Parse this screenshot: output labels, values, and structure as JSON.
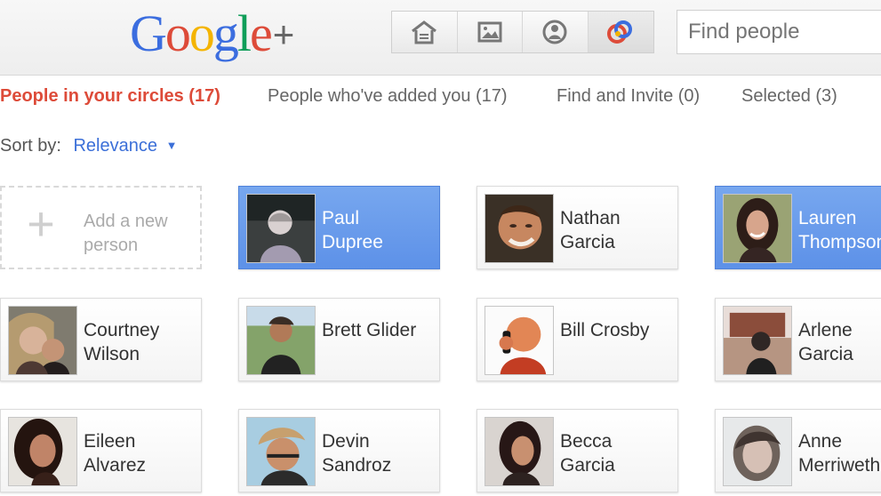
{
  "brand": {
    "colors": {
      "google_blue": "#3b6ddf",
      "google_red": "#dd4b39",
      "google_yellow": "#f4b400",
      "google_green": "#0f9d58",
      "selected_blue": "#5d91e8",
      "active_tab_red": "#dd4b39",
      "link_blue": "#3b6fd8"
    },
    "logo": {
      "letters": [
        "G",
        "o",
        "o",
        "g",
        "l",
        "e"
      ],
      "plus": "+"
    }
  },
  "header": {
    "search": {
      "placeholder": "Find people"
    },
    "nav_icons": [
      {
        "icon": "home-icon"
      },
      {
        "icon": "photos-icon"
      },
      {
        "icon": "profile-icon"
      },
      {
        "icon": "circles-icon"
      }
    ]
  },
  "tabs": [
    {
      "label": "People in your circles (17)"
    },
    {
      "label": "People who've added you (17)"
    },
    {
      "label": "Find and Invite (0)"
    },
    {
      "label": "Selected (3)"
    }
  ],
  "sort": {
    "label": "Sort by:",
    "value": "Relevance"
  },
  "people": [
    {
      "add_label": "Add a new\nperson"
    },
    {
      "name": "Paul\nDupree",
      "selected": true
    },
    {
      "name": "Nathan\nGarcia",
      "selected": false
    },
    {
      "name": "Lauren\nThompson",
      "selected": true
    },
    {
      "name": "Courtney\nWilson",
      "selected": false
    },
    {
      "name": "Brett Glider",
      "selected": false
    },
    {
      "name": "Bill Crosby",
      "selected": false
    },
    {
      "name": "Arlene\nGarcia",
      "selected": false
    },
    {
      "name": "Eileen\nAlvarez",
      "selected": false
    },
    {
      "name": "Devin\nSandroz",
      "selected": false
    },
    {
      "name": "Becca\nGarcia",
      "selected": false
    },
    {
      "name": "Anne\nMerriwether",
      "selected": false
    }
  ]
}
